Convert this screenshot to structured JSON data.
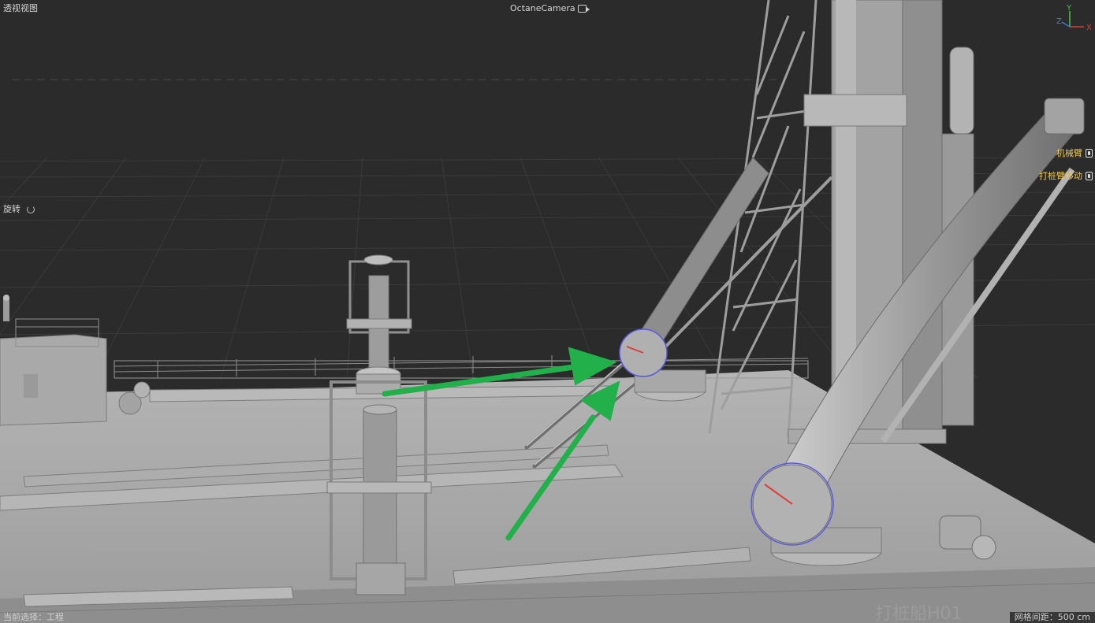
{
  "viewport": {
    "view_name": "透视视图",
    "camera_name": "OctaneCamera",
    "mode_label": "旋转",
    "status_left": "当前选择：工程",
    "status_right": "网格间距：500 cm",
    "hull_marking": "打桩船H01"
  },
  "object_tags": [
    {
      "label": "机械臂",
      "icon": "lock-toggle-icon"
    },
    {
      "label": "打桩臂移动",
      "icon": "lock-toggle-icon"
    }
  ],
  "axis_gizmo": {
    "x_label": "X",
    "y_label": "Y",
    "z_label": "Z"
  },
  "colors": {
    "background": "#2b2b2b",
    "grid": "#3c3c3c",
    "model": "#a7a7a7",
    "annotation_arrow": "#22b04b",
    "tag_text": "#f2c94c",
    "axis_x": "#e03c3c",
    "axis_y": "#4cc24c",
    "axis_z": "#3c7be0",
    "selection_ring": "#5a5ae0"
  }
}
